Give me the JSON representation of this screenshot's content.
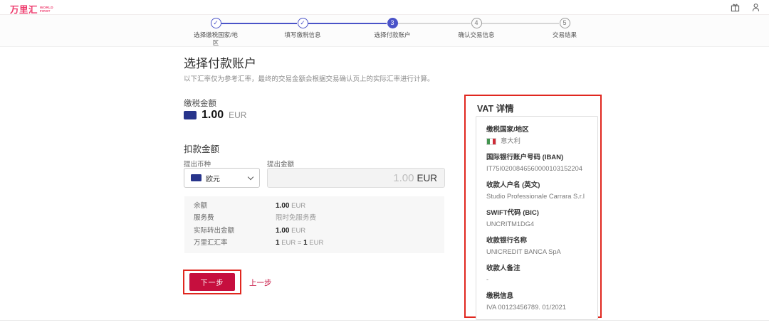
{
  "header": {
    "logo_cn": "万里汇",
    "logo_en1": "WORLD",
    "logo_en2": "FIRST"
  },
  "stepper": {
    "steps": [
      {
        "glyph": "✓",
        "label": "选择缴税国家/地区",
        "state": "done"
      },
      {
        "glyph": "✓",
        "label": "填写缴税信息",
        "state": "done"
      },
      {
        "glyph": "3",
        "label": "选择付款账户",
        "state": "active"
      },
      {
        "glyph": "4",
        "label": "确认交易信息",
        "state": "todo"
      },
      {
        "glyph": "5",
        "label": "交易结果",
        "state": "todo"
      }
    ]
  },
  "main": {
    "title": "选择付款账户",
    "subtitle": "以下汇率仅为参考汇率，最终的交易金额会根据交易确认页上的实际汇率进行计算。",
    "tax": {
      "label": "缴税金额",
      "amount": "1.00",
      "currency": "EUR"
    },
    "deduct": {
      "heading": "扣款金额",
      "currency_label": "提出币种",
      "currency_value": "欧元",
      "amount_label": "提出金额",
      "amount_value": "1.00",
      "amount_currency": "EUR"
    },
    "summary": {
      "rows": [
        {
          "label": "余额",
          "s1": "1.00",
          "r1": " EUR",
          "s2": "",
          "r2": ""
        },
        {
          "label": "服务费",
          "s1": "",
          "r1": "限时免服务费",
          "s2": "",
          "r2": ""
        },
        {
          "label": "实际转出金额",
          "s1": "1.00",
          "r1": " EUR",
          "s2": "",
          "r2": ""
        },
        {
          "label": "万里汇汇率",
          "s1": "1",
          "r1": " EUR = ",
          "s2": "1",
          "r2": " EUR"
        }
      ]
    },
    "buttons": {
      "next": "下一步",
      "prev": "上一步"
    }
  },
  "vat": {
    "title": "VAT 详情",
    "fields": [
      {
        "label": "缴税国家/地区",
        "value": "意大利"
      },
      {
        "label": "国际银行账户号码 (IBAN)",
        "value": "IT75I0200846560000103152204"
      },
      {
        "label": "收款人户名 (英文)",
        "value": "Studio Professionale Carrara S.r.l"
      },
      {
        "label": "SWIFT代码 (BIC)",
        "value": "UNCRITM1DG4"
      },
      {
        "label": "收款银行名称",
        "value": "UNICREDIT BANCA SpA"
      },
      {
        "label": "收款人备注",
        "value": "-"
      },
      {
        "label": "缴税信息",
        "value": "IVA 00123456789. 01/2021"
      }
    ]
  },
  "colors": {
    "brand_pink": "#ee3a6c",
    "button_red": "#c60f3e",
    "annotation_red": "#e0271f",
    "stepper_blue": "#4a53c8",
    "eu_flag_navy": "#27348b",
    "italy_green": "#43954f",
    "italy_red": "#ce2b37"
  }
}
